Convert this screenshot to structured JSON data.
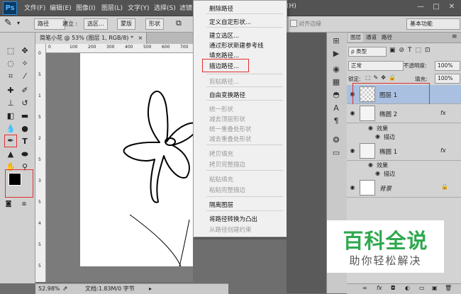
{
  "app": {
    "logo": "Ps"
  },
  "menubar": {
    "items": [
      "文件(F)",
      "编辑(E)",
      "图像(I)",
      "图层(L)",
      "文字(Y)",
      "选择(S)",
      "滤镜"
    ],
    "window_buttons": [
      "—",
      "□",
      "✕"
    ],
    "partial_right": "(H)"
  },
  "options": {
    "tool_mode": "路径",
    "make_label": "建立 :",
    "selection_btn": "选区...",
    "mask_btn": "蒙版",
    "shape_btn": "形状",
    "align_edges": "对齐边缘",
    "workspace": "基本功能"
  },
  "document": {
    "tab_title": "简笔小花 @ 53% (图层 1, RGB/8) *",
    "close_glyph": "×",
    "ruler_h": [
      "0",
      "100",
      "200",
      "300",
      "400",
      "500",
      "600",
      "700",
      "800",
      "900"
    ],
    "ruler_v": [
      "0",
      "5",
      "1",
      "5",
      "2",
      "5",
      "3",
      "5",
      "4",
      "5",
      "5"
    ]
  },
  "status": {
    "zoom": "52.98%",
    "doc_info": "文档:1.83M/0 字节"
  },
  "context_menu": {
    "items": [
      {
        "label": "删除路径",
        "enabled": true
      },
      {
        "label": "定义自定形状...",
        "enabled": true
      },
      {
        "label": "建立选区...",
        "enabled": true
      },
      {
        "label": "通过形状新建参考线",
        "enabled": true
      },
      {
        "label": "填充路径...",
        "enabled": true
      },
      {
        "label": "描边路径...",
        "enabled": true
      },
      {
        "label": "剪贴路径...",
        "enabled": false
      },
      {
        "label": "自由变换路径",
        "enabled": true
      },
      {
        "label": "统一形状",
        "enabled": false
      },
      {
        "label": "减去顶层形状",
        "enabled": false
      },
      {
        "label": "统一重叠处形状",
        "enabled": false
      },
      {
        "label": "减去重叠处形状",
        "enabled": false
      },
      {
        "label": "拷贝填充",
        "enabled": false
      },
      {
        "label": "拷贝完整描边",
        "enabled": false
      },
      {
        "label": "粘贴填充",
        "enabled": false
      },
      {
        "label": "粘贴完整描边",
        "enabled": false
      },
      {
        "label": "隔离图层",
        "enabled": true
      },
      {
        "label": "将路径转换为凸出",
        "enabled": true
      },
      {
        "label": "从路径创建约束",
        "enabled": false
      }
    ]
  },
  "layers_panel": {
    "tabs": [
      "图层",
      "通道",
      "路径"
    ],
    "filter_kind": "ρ 类型",
    "blend_mode": "正常",
    "opacity_label": "不透明度:",
    "opacity_value": "100%",
    "lock_label": "锁定:",
    "fill_label": "填充:",
    "fill_value": "100%",
    "layers": [
      {
        "name": "图层 1",
        "fx": "",
        "selected": true
      },
      {
        "name": "椭圆 2",
        "fx": "fx",
        "effects_label": "效果",
        "effect": "描边"
      },
      {
        "name": "椭圆 1",
        "fx": "fx",
        "effects_label": "效果",
        "effect": "描边"
      },
      {
        "name": "背景",
        "lock": "🔒"
      }
    ],
    "footer_icons": [
      "∞",
      "fx",
      "◘",
      "◐",
      "▭",
      "▣",
      "🗑"
    ]
  },
  "watermark": {
    "title": "百科全说",
    "subtitle": "助你轻松解决"
  },
  "colors": {
    "highlight_red": "#e03030",
    "selected_layer": "#a9c0e0",
    "watermark_green": "#2fa84f"
  }
}
